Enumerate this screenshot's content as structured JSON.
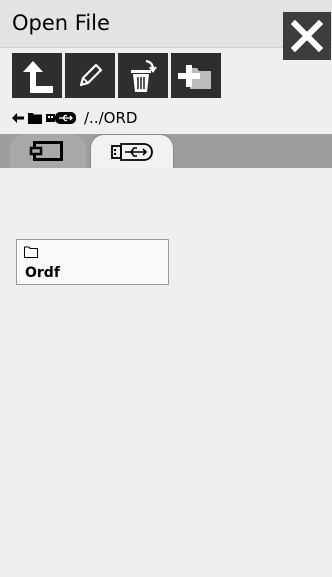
{
  "window": {
    "title": "Open File",
    "close_icon": "close-icon"
  },
  "toolbar": {
    "buttons": [
      {
        "icon": "parent-folder-icon"
      },
      {
        "icon": "rename-pencil-icon"
      },
      {
        "icon": "delete-trash-icon"
      },
      {
        "icon": "new-folder-icon"
      }
    ]
  },
  "path": {
    "back_icon": "back-arrow-icon",
    "device_icon": "usb-drive-icon",
    "text": "/../ORD"
  },
  "tabs": [
    {
      "icon": "machine-memory-icon",
      "selected": false
    },
    {
      "icon": "usb-icon",
      "selected": true
    }
  ],
  "files": [
    {
      "icon": "folder-icon",
      "name": "Ordf"
    }
  ],
  "colors": {
    "titlebar": "#e3e3e3",
    "button_dark": "#2e2e2e",
    "tabstrip": "#9e9e9e",
    "selected_tab": "#f2f2f2",
    "content_bg": "#efefef"
  }
}
